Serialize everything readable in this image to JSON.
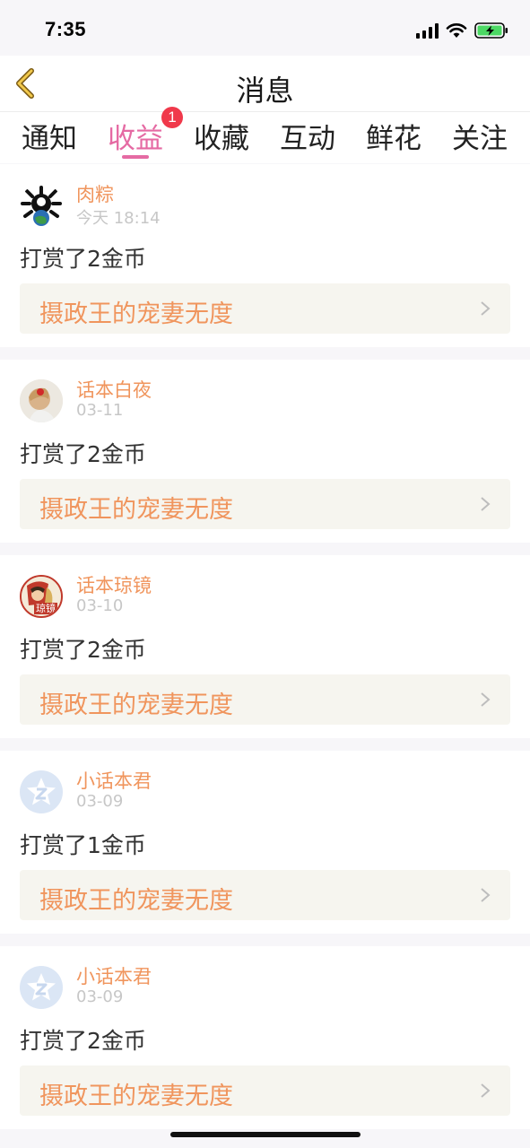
{
  "status": {
    "time": "7:35"
  },
  "nav": {
    "title": "消息"
  },
  "tabs": [
    {
      "label": "通知"
    },
    {
      "label": "收益",
      "badge": "1",
      "active": true
    },
    {
      "label": "收藏"
    },
    {
      "label": "互动"
    },
    {
      "label": "鲜花"
    },
    {
      "label": "关注"
    }
  ],
  "items": [
    {
      "user": "肉粽",
      "date": "今天 18:14",
      "action": "打赏了2金币",
      "book": "摄政王的宠妻无度",
      "avatar_icon": "dark-emblem-avatar"
    },
    {
      "user": "话本白夜",
      "date": "03-11",
      "action": "打赏了2金币",
      "book": "摄政王的宠妻无度",
      "avatar_icon": "photo-avatar"
    },
    {
      "user": "话本琼镜",
      "date": "03-10",
      "action": "打赏了2金币",
      "book": "摄政王的宠妻无度",
      "avatar_icon": "illustrated-avatar",
      "avatar_tag": "琼镜"
    },
    {
      "user": "小话本君",
      "date": "03-09",
      "action": "打赏了1金币",
      "book": "摄政王的宠妻无度",
      "avatar_icon": "default-star-avatar"
    },
    {
      "user": "小话本君",
      "date": "03-09",
      "action": "打赏了2金币",
      "book": "摄政王的宠妻无度",
      "avatar_icon": "default-star-avatar"
    }
  ],
  "colors": {
    "accent": "#e56aa3",
    "name": "#f0955d",
    "badge": "#f0394b"
  }
}
